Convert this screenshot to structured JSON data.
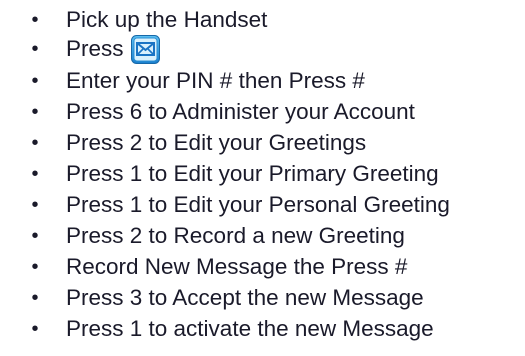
{
  "instructions": {
    "bullet": "•",
    "steps": [
      {
        "text": "Pick up the Handset"
      },
      {
        "text": "Press",
        "icon": "message-envelope-icon"
      },
      {
        "text": "Enter your PIN # then Press #"
      },
      {
        "text": "Press 6 to Administer your Account"
      },
      {
        "text": "Press 2 to Edit your Greetings"
      },
      {
        "text": "Press 1 to Edit your Primary Greeting"
      },
      {
        "text": "Press 1 to Edit your Personal Greeting"
      },
      {
        "text": "Press 2 to Record a new Greeting"
      },
      {
        "text": "Record New Message the Press #"
      },
      {
        "text": "Press 3 to Accept the new Message"
      },
      {
        "text": "Press 1 to activate the new Message"
      }
    ]
  },
  "colors": {
    "text": "#1a1a2a",
    "icon_blue": "#1e8fd6",
    "icon_light": "#bfe6fb"
  }
}
